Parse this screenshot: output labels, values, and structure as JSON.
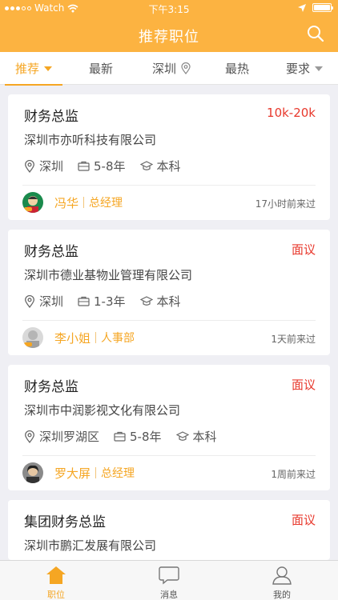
{
  "status_bar": {
    "carrier": "Watch",
    "time": "下午3:15"
  },
  "nav": {
    "title": "推荐职位"
  },
  "filters": [
    {
      "label": "推荐",
      "has_caret": true,
      "active": true
    },
    {
      "label": "最新"
    },
    {
      "label": "深圳",
      "has_pin": true
    },
    {
      "label": "最热"
    },
    {
      "label": "要求",
      "has_caret": true
    }
  ],
  "jobs": [
    {
      "title": "财务总监",
      "salary": "10k-20k",
      "company": "深圳市亦听科技有限公司",
      "location": "深圳",
      "experience": "5-8年",
      "education": "本科",
      "recruiter": {
        "name": "冯华",
        "role": "总经理"
      },
      "last_seen": "17小时前来过"
    },
    {
      "title": "财务总监",
      "salary": "面议",
      "company": "深圳市德业基物业管理有限公司",
      "location": "深圳",
      "experience": "1-3年",
      "education": "本科",
      "recruiter": {
        "name": "李小姐",
        "role": "人事部"
      },
      "last_seen": "1天前来过"
    },
    {
      "title": "财务总监",
      "salary": "面议",
      "company": "深圳市中润影视文化有限公司",
      "location": "深圳罗湖区",
      "experience": "5-8年",
      "education": "本科",
      "recruiter": {
        "name": "罗大屏",
        "role": "总经理"
      },
      "last_seen": "1周前来过"
    },
    {
      "title": "集团财务总监",
      "salary": "面议",
      "company": "深圳市鹏汇发展有限公司"
    }
  ],
  "tabbar": [
    {
      "label": "职位",
      "icon": "home-icon",
      "active": true
    },
    {
      "label": "消息",
      "icon": "message-icon"
    },
    {
      "label": "我的",
      "icon": "profile-icon"
    }
  ],
  "colors": {
    "accent": "#fcb341",
    "salary": "#e8382c",
    "highlight": "#f5a623"
  }
}
